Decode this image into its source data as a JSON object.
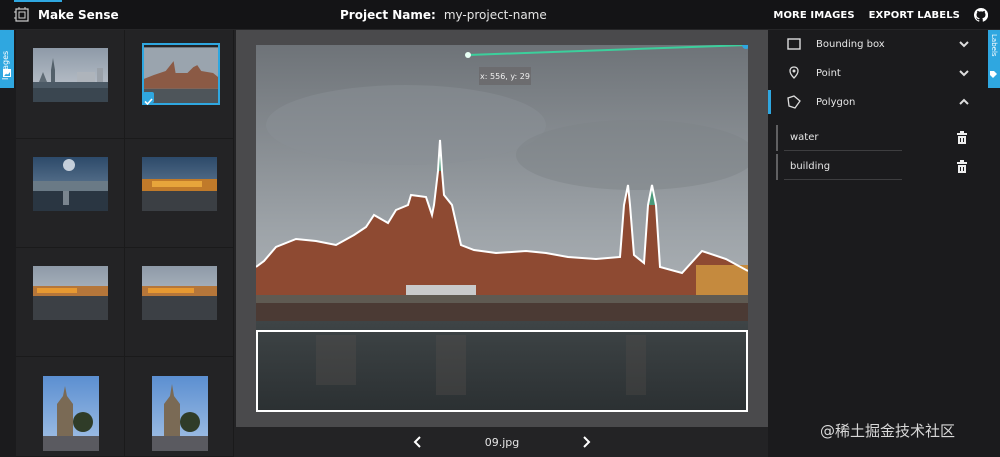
{
  "app": {
    "title": "Make Sense"
  },
  "project": {
    "label": "Project Name:",
    "name": "my-project-name"
  },
  "actions": {
    "more_images": "MORE IMAGES",
    "export_labels": "EXPORT LABELS"
  },
  "side_tabs": {
    "left": "Images",
    "right": "Labels"
  },
  "editor": {
    "cursor_readout": "x: 556, y: 29",
    "filename": "09.jpg"
  },
  "tools": [
    {
      "label": "Bounding box",
      "icon": "bounding-box-icon",
      "expanded": false
    },
    {
      "label": "Point",
      "icon": "point-icon",
      "expanded": false
    },
    {
      "label": "Polygon",
      "icon": "polygon-icon",
      "expanded": true
    }
  ],
  "labels": [
    {
      "name": "water"
    },
    {
      "name": "building"
    }
  ],
  "watermark": "@稀土掘金技术社区",
  "colors": {
    "accent": "#2fa7e0",
    "active_line": "#3ccf9c",
    "polygon": "#ffffff"
  }
}
